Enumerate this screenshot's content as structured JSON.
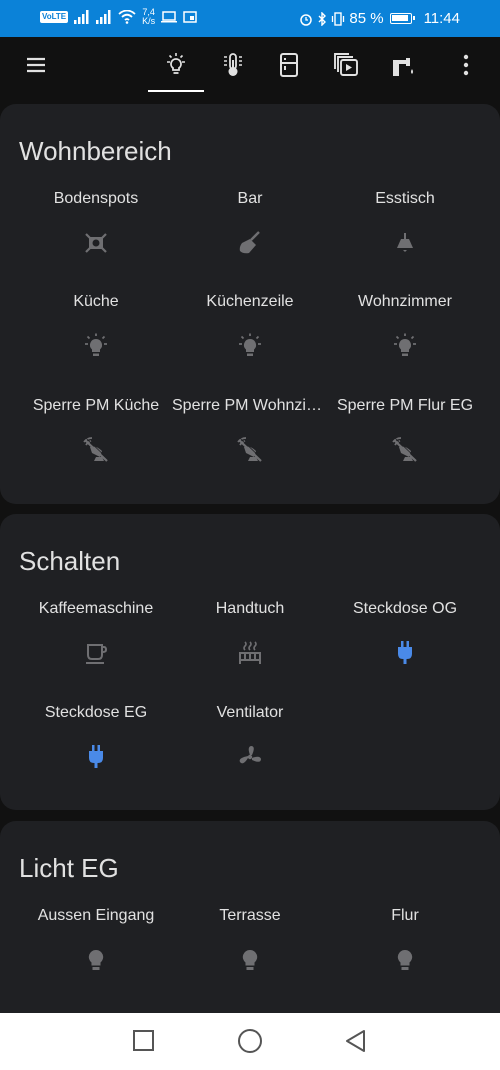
{
  "status_bar": {
    "volte": "VoLTE",
    "speed_value": "7,4",
    "speed_unit": "K/s",
    "battery": "85 %",
    "time": "11:44"
  },
  "toolbar": {
    "menu_icon": "menu-icon",
    "tabs": [
      {
        "icon": "lightbulb-icon",
        "active": true
      },
      {
        "icon": "thermometer-icon",
        "active": false
      },
      {
        "icon": "fridge-icon",
        "active": false
      },
      {
        "icon": "media-icon",
        "active": false
      },
      {
        "icon": "water-tap-icon",
        "active": false
      }
    ],
    "more_icon": "more-vertical-icon"
  },
  "cards": [
    {
      "title": "Wohnbereich",
      "entities": [
        {
          "name": "Bodenspots",
          "icon": "spotlight-icon"
        },
        {
          "name": "Bar",
          "icon": "broom-light-icon"
        },
        {
          "name": "Esstisch",
          "icon": "ceiling-light-icon"
        },
        {
          "name": "Küche",
          "icon": "lightbulb-on-icon"
        },
        {
          "name": "Küchenzeile",
          "icon": "lightbulb-on-icon"
        },
        {
          "name": "Wohnzimmer",
          "icon": "lightbulb-on-icon"
        },
        {
          "name": "Sperre PM Küche",
          "icon": "motion-sensor-off-icon"
        },
        {
          "name": "Sperre PM Wohnzimmer",
          "icon": "motion-sensor-off-icon"
        },
        {
          "name": "Sperre PM Flur EG",
          "icon": "motion-sensor-off-icon"
        }
      ]
    },
    {
      "title": "Schalten",
      "entities": [
        {
          "name": "Kaffeemaschine",
          "icon": "coffee-maker-icon"
        },
        {
          "name": "Handtuch",
          "icon": "towel-heater-icon"
        },
        {
          "name": "Steckdose OG",
          "icon": "power-plug-icon",
          "state_color": "#4a8ae8"
        },
        {
          "name": "Steckdose EG",
          "icon": "power-plug-icon",
          "state_color": "#4a8ae8"
        },
        {
          "name": "Ventilator",
          "icon": "fan-icon"
        }
      ]
    },
    {
      "title": "Licht EG",
      "entities": [
        {
          "name": "Aussen Eingang",
          "icon": "lightbulb-icon"
        },
        {
          "name": "Terrasse",
          "icon": "lightbulb-icon"
        },
        {
          "name": "Flur",
          "icon": "lightbulb-icon"
        }
      ]
    }
  ],
  "nav_bar": {
    "recents_icon": "square-icon",
    "home_icon": "circle-icon",
    "back_icon": "triangle-back-icon"
  },
  "colors": {
    "status_bar": "#0b82d8",
    "background": "#111111",
    "card": "#1f2023",
    "icon_off": "#6f6f72",
    "icon_on": "#4a8ae8"
  }
}
